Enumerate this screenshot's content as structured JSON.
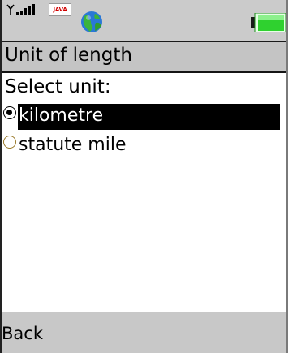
{
  "status": {
    "signal_icon": "signal-strength-icon",
    "java_label": "JAVA",
    "app_icon": "globe-icon",
    "battery_icon": "battery-icon"
  },
  "title": "Unit of length",
  "prompt": "Select unit:",
  "options": [
    {
      "label": "kilometre",
      "selected": true
    },
    {
      "label": "statute mile",
      "selected": false
    }
  ],
  "softkeys": {
    "left": "Back"
  },
  "colors": {
    "bar": "#c4c4c4",
    "highlight": "#000000",
    "battery": "#2fd12f",
    "java": "#d00000"
  }
}
